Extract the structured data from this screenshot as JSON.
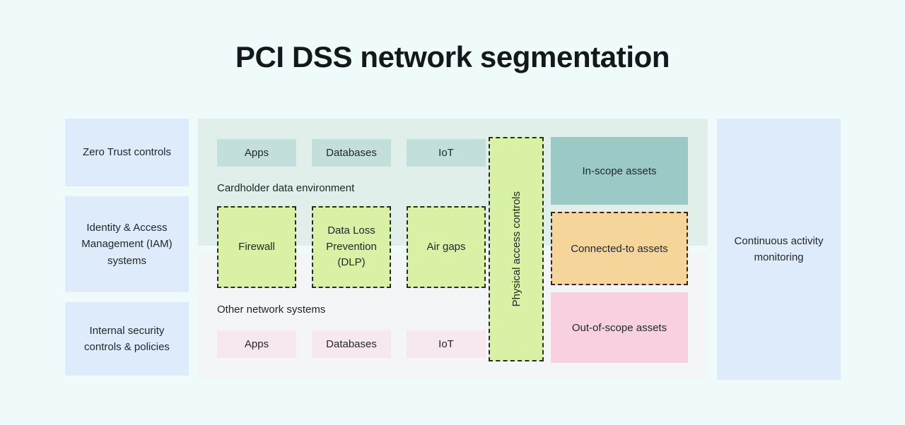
{
  "title": "PCI DSS network segmentation",
  "left_sidebar": {
    "items": [
      {
        "label": "Zero Trust controls"
      },
      {
        "label": "Identity & Access Management (IAM) systems"
      },
      {
        "label": "Internal security controls & policies"
      }
    ]
  },
  "right_sidebar": {
    "items": [
      {
        "label": "Continuous activity monitoring"
      }
    ]
  },
  "cde": {
    "section_label": "Cardholder data environment",
    "assets": [
      {
        "label": "Apps"
      },
      {
        "label": "Databases"
      },
      {
        "label": "IoT"
      }
    ],
    "controls": [
      {
        "label": "Firewall"
      },
      {
        "label": "Data Loss Prevention (DLP)"
      },
      {
        "label": "Air gaps"
      }
    ]
  },
  "other_network": {
    "section_label": "Other network systems",
    "assets": [
      {
        "label": "Apps"
      },
      {
        "label": "Databases"
      },
      {
        "label": "IoT"
      }
    ]
  },
  "physical": {
    "label": "Physical access controls"
  },
  "scope": {
    "items": [
      {
        "label": "In-scope assets"
      },
      {
        "label": "Connected-to assets"
      },
      {
        "label": "Out-of-scope assets"
      }
    ]
  },
  "colors": {
    "page_background": "#effafb",
    "sidebar_box": "#ddebfb",
    "cde_panel": "#e1efeb",
    "other_panel": "#f4f5f7",
    "cde_chip": "#c2dfdc",
    "other_chip": "#f7e7ee",
    "control_green": "#d8f1a4",
    "in_scope_teal": "#9ac9c6",
    "connected_orange": "#f6d59b",
    "out_of_scope_pink": "#f8d0e0",
    "dash_border": "#2a2a2a",
    "text": "#22282c"
  }
}
